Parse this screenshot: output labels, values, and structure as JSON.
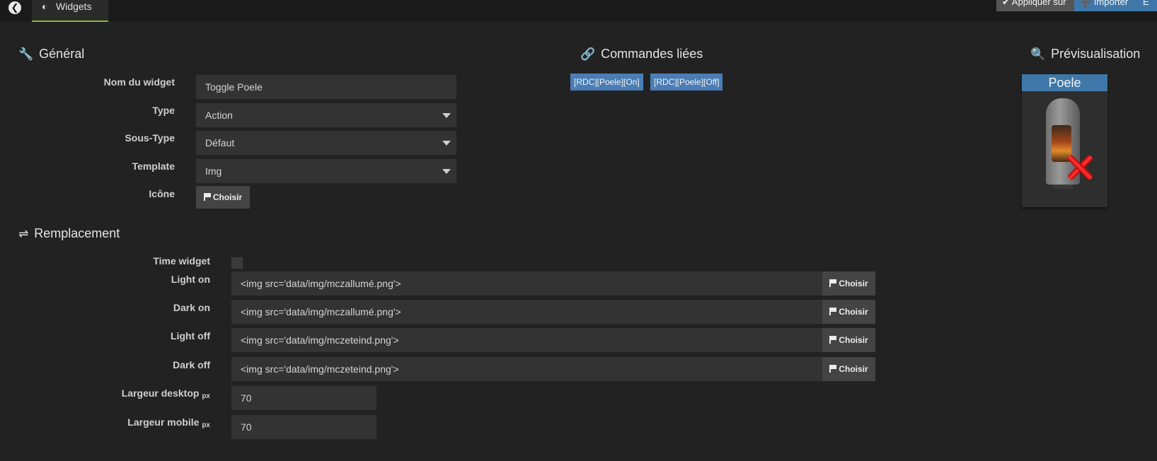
{
  "topbar": {
    "tab_label": "Widgets",
    "apply_label": "Appliquer sur",
    "import_label": "Importer",
    "extra_label": "E"
  },
  "general": {
    "title": "Général",
    "name_label": "Nom du widget",
    "name_value": "Toggle Poele",
    "type_label": "Type",
    "type_value": "Action",
    "subtype_label": "Sous-Type",
    "subtype_value": "Défaut",
    "template_label": "Template",
    "template_value": "Img",
    "icon_label": "Icône",
    "choose_label": "Choisir"
  },
  "commands": {
    "title": "Commandes liées",
    "items": [
      "[RDC][Poele][On]",
      "[RDC][Poele][Off]"
    ]
  },
  "preview": {
    "title": "Prévisualisation",
    "widget_name": "Poele"
  },
  "replacement": {
    "title": "Remplacement",
    "time_widget_label": "Time widget",
    "light_on_label": "Light on",
    "light_on_value": "<img src='data/img/mczallumé.png'>",
    "dark_on_label": "Dark on",
    "dark_on_value": "<img src='data/img/mczallumé.png'>",
    "light_off_label": "Light off",
    "light_off_value": "<img src='data/img/mczeteind.png'>",
    "dark_off_label": "Dark off",
    "dark_off_value": "<img src='data/img/mczeteind.png'>",
    "desktop_width_label": "Largeur desktop",
    "desktop_width_value": "70",
    "mobile_width_label": "Largeur mobile",
    "mobile_width_value": "70",
    "unit": "px",
    "choose_label": "Choisir"
  },
  "colors": {
    "background": "#222222",
    "accent_blue": "#3f78a8",
    "tag_blue": "#4a7db6",
    "tab_underline": "#8fb23a"
  }
}
